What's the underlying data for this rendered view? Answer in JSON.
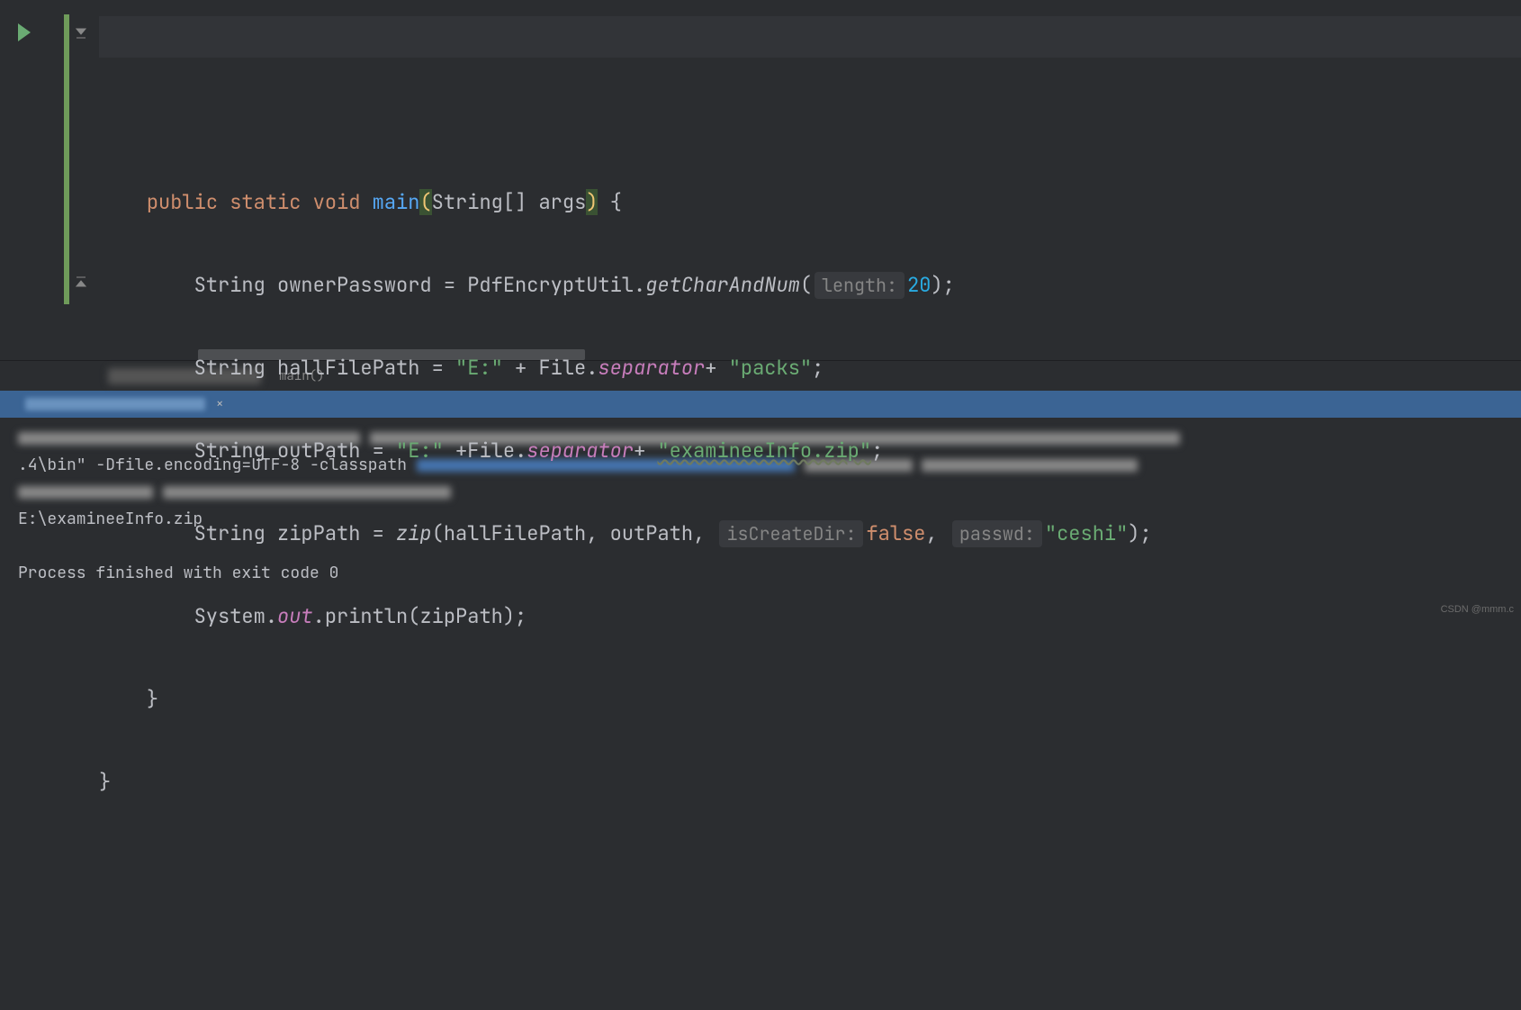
{
  "code": {
    "l1": {
      "kw_public": "public",
      "kw_static": "static",
      "kw_void": "void",
      "method": "main",
      "param_type": "String[]",
      "param_name": "args",
      "brace": "{"
    },
    "l2": {
      "type": "String",
      "var": "ownerPassword",
      "eq": "=",
      "cls": "PdfEncryptUtil",
      "dot": ".",
      "call": "getCharAndNum",
      "hint_length": "length:",
      "arg": "20",
      "tail": ");"
    },
    "l3": {
      "type": "String",
      "var": "hallFilePath",
      "eq": "=",
      "s1": "\"E:\"",
      "plus1": "+",
      "file": "File",
      "dot": ".",
      "sep": "separator",
      "plus2": "+",
      "s2": "\"packs\"",
      "tail": ";"
    },
    "l4": {
      "type": "String",
      "var": "outPath",
      "eq": "=",
      "s1": "\"E:\"",
      "plus1": "+",
      "file": "File",
      "dot": ".",
      "sep": "separator",
      "plus2": "+",
      "s2": "\"examineeInfo.zip\"",
      "tail": ";"
    },
    "l5": {
      "type": "String",
      "var": "zipPath",
      "eq": "=",
      "call": "zip",
      "a1": "hallFilePath",
      "a2": "outPath",
      "hint_dir": "isCreateDir:",
      "a3": "false",
      "hint_pwd": "passwd:",
      "a4": "\"ceshi\"",
      "tail": ");"
    },
    "l6": {
      "sys": "System",
      "dot1": ".",
      "out": "out",
      "dot2": ".",
      "println": "println",
      "arg": "zipPath",
      "tail": ");"
    },
    "l7": {
      "brace": "}"
    },
    "l8": {
      "brace": "}"
    }
  },
  "breadcrumb": {
    "method": "main()"
  },
  "console": {
    "line1_mid": ".4\\bin\" -Dfile.encoding=UTF-8 -classpath",
    "output": "E:\\examineeInfo.zip",
    "exit": "Process finished with exit code 0"
  },
  "watermark": "CSDN @mmm.c"
}
